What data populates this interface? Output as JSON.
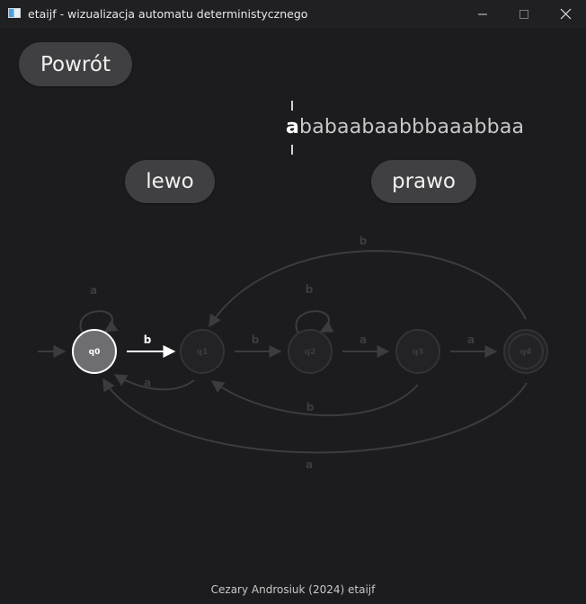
{
  "window": {
    "title": "etaijf - wizualizacja automatu deterministycznego",
    "icon": "app-window-icon"
  },
  "buttons": {
    "back": "Powrót",
    "left": "lewo",
    "right": "prawo"
  },
  "tape": {
    "current_char": "a",
    "rest": "babaabaabbbaaabbaa"
  },
  "automaton": {
    "states": [
      "q0",
      "q1",
      "q2",
      "q3",
      "q4"
    ],
    "active_state": "q0",
    "accepting_state": "q4",
    "transitions": [
      {
        "from": "q0",
        "to": "q0",
        "label": "a"
      },
      {
        "from": "q0",
        "to": "q1",
        "label": "b",
        "active": true
      },
      {
        "from": "q1",
        "to": "q0",
        "label": "a"
      },
      {
        "from": "q1",
        "to": "q2",
        "label": "b"
      },
      {
        "from": "q2",
        "to": "q2",
        "label": "b"
      },
      {
        "from": "q2",
        "to": "q3",
        "label": "a"
      },
      {
        "from": "q3",
        "to": "q1",
        "label": "b"
      },
      {
        "from": "q3",
        "to": "q4",
        "label": "a"
      },
      {
        "from": "q4",
        "to": "q1",
        "label": "b"
      },
      {
        "from": "q4",
        "to": "q0",
        "label": "a"
      }
    ]
  },
  "colors": {
    "background": "#1c1c1f",
    "button": "#404042",
    "active_state_fill": "#6e6e70",
    "inactive": "#3a3a3c",
    "active_edge": "#ffffff"
  },
  "footer": "Cezary Androsiuk (2024) etaijf"
}
